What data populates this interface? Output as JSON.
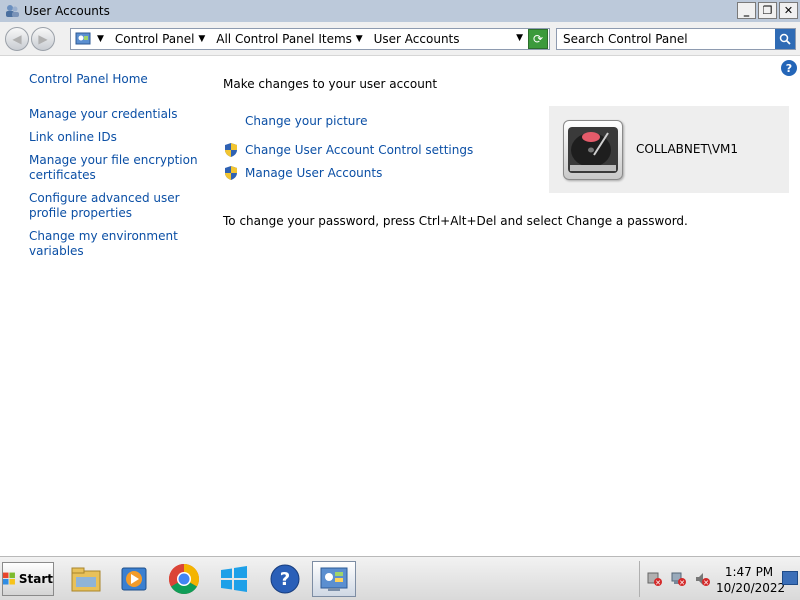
{
  "window": {
    "title": "User Accounts"
  },
  "window_buttons": {
    "minimize": "_",
    "maximize": "❐",
    "close": "✕"
  },
  "address_bar": {
    "crumbs": [
      "Control Panel",
      "All Control Panel Items",
      "User Accounts"
    ]
  },
  "search": {
    "placeholder": "Search Control Panel"
  },
  "left_nav": {
    "home": "Control Panel Home",
    "items": [
      "Manage your credentials",
      "Link online IDs",
      "Manage your file encryption certificates",
      "Configure advanced user profile properties",
      "Change my environment variables"
    ]
  },
  "main": {
    "heading": "Make changes to your user account",
    "tasks": [
      {
        "label": "Change your picture",
        "shield": false
      },
      {
        "label": "Change User Account Control settings",
        "shield": true
      },
      {
        "label": "Manage User Accounts",
        "shield": true
      }
    ],
    "password_note": "To change your password, press Ctrl+Alt+Del and select Change a password."
  },
  "user": {
    "name": "COLLABNET\\VM1"
  },
  "taskbar": {
    "start_label": "Start",
    "pinned": [
      "explorer-icon",
      "media-player-icon",
      "chrome-icon",
      "windows-store-icon",
      "help-icon",
      "control-panel-icon"
    ],
    "clock_time": "1:47 PM",
    "clock_date": "10/20/2022"
  },
  "colors": {
    "link": "#0b4fa5",
    "titlebar": "#bcc9da",
    "tile_bg": "#eeeeee"
  }
}
